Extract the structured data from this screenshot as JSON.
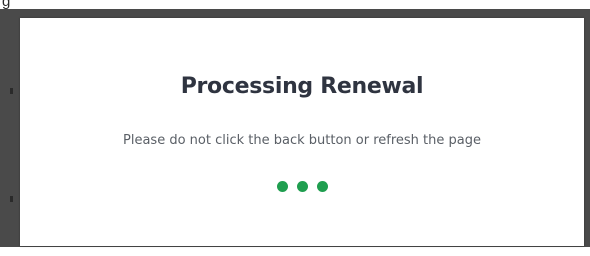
{
  "modal": {
    "title": "Processing Renewal",
    "message": "Please do not click the back button or refresh the page"
  },
  "loader": {
    "dot_count": 3,
    "color": "#1f9e4f"
  },
  "backdrop": {
    "color": "#4a4a4a"
  }
}
